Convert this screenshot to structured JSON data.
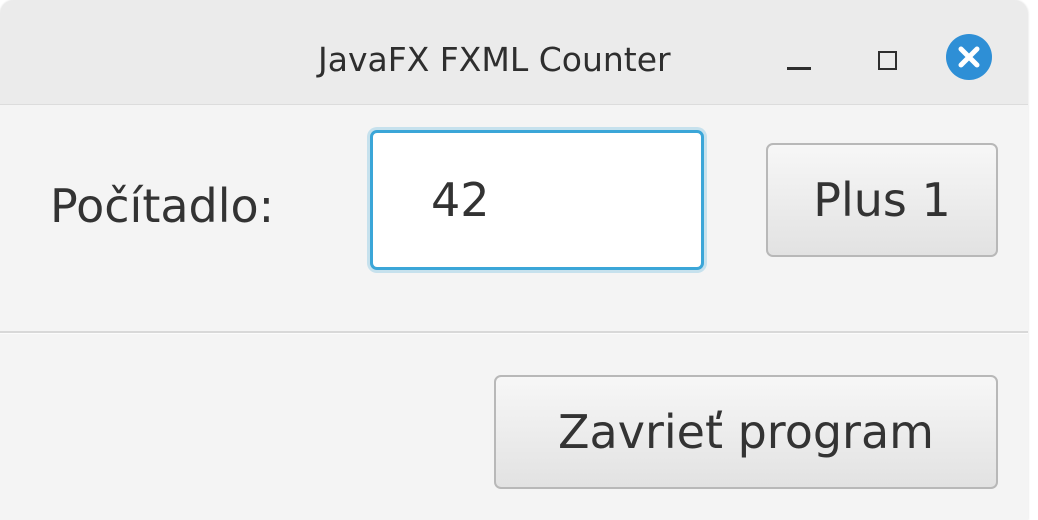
{
  "window": {
    "title": "JavaFX FXML Counter"
  },
  "icons": {
    "minimize": "minimize-icon",
    "maximize": "maximize-icon",
    "close": "close-icon",
    "close_color": "#2e8fd6"
  },
  "counter": {
    "label": "Počítadlo:",
    "value": "42",
    "focus_color": "#3ba6d8"
  },
  "buttons": {
    "plus_label": "Plus 1",
    "close_program_label": "Zavrieť program"
  }
}
